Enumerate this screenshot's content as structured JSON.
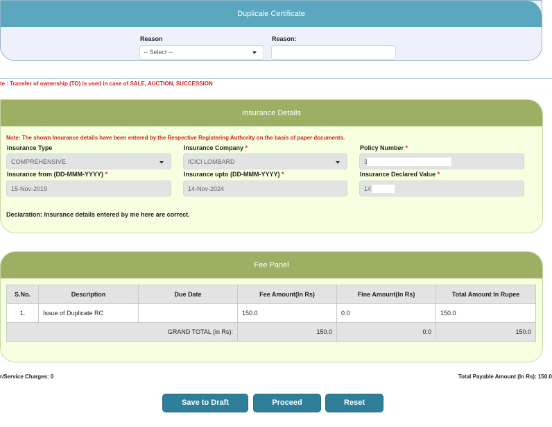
{
  "duplicate_certificate": {
    "title": "Duplicale Certificate",
    "reason_label": "Reason",
    "reason_select_value": "-- Select --",
    "reason_text_label": "Reason:",
    "reason_text_value": ""
  },
  "note_transfer": {
    "prefix": "te : Transfer of ownership (TO) is used in case of ",
    "emphasis": "SALE, AUCTION, SUCCESSION"
  },
  "insurance": {
    "title": "Insurance Details",
    "note": "Note: The shown Insurance details have been entered by the Respective Registering Authority on the basis of paper documents.",
    "type_label": "Insurance Type",
    "type_value": "COMPREHENSIVE",
    "company_label": "Insurance Company",
    "company_value": "ICICI LOMBARD",
    "policy_label": "Policy Number",
    "policy_value": "3",
    "from_label": "Insurance from (DD-MMM-YYYY)",
    "from_value": "15-Nov-2019",
    "upto_label": "Insurance upto (DD-MMM-YYYY)",
    "upto_value": "14-Nov-2024",
    "declared_label": "Insurance Declared Value",
    "declared_value": "14",
    "required_mark": "*",
    "declaration": "Declaration: Insurance details entered by me here are correct."
  },
  "fee_panel": {
    "title": "Fee Panel",
    "columns": [
      "S.No.",
      "Description",
      "Due Date",
      "Fee Amount(In Rs)",
      "Fine Amount(In Rs)",
      "Total Amount In Rupee"
    ],
    "rows": [
      {
        "sno": "1.",
        "description": "Issue of Duplicate RC",
        "due_date": "",
        "fee": "150.0",
        "fine": "0.0",
        "total": "150.0"
      }
    ],
    "grand_total_label": "GRAND TOTAL (in Rs):",
    "grand_total_fee": "150.0",
    "grand_total_fine": "0.0",
    "grand_total_total": "150.0"
  },
  "footer": {
    "service_charges": "r/Service Charges: 0",
    "total_payable": "Total Payable Amount (In Rs): 150.0"
  },
  "buttons": {
    "save_draft": "Save to Draft",
    "proceed": "Proceed",
    "reset": "Reset"
  },
  "colors": {
    "dup_header": "#5ba7c0",
    "green_header": "#9caf62",
    "button": "#2f7f9b",
    "note_red": "#d81e1e"
  }
}
